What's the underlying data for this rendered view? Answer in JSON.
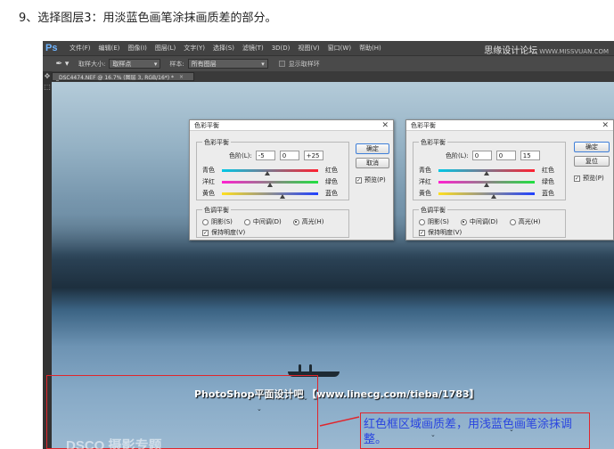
{
  "heading": "9、选择图层3：用淡蓝色画笔涂抹画质差的部分。",
  "app": {
    "logo": "Ps",
    "menu": [
      "文件(F)",
      "编辑(E)",
      "图像(I)",
      "图层(L)",
      "文字(Y)",
      "选择(S)",
      "滤镜(T)",
      "3D(D)",
      "视图(V)",
      "窗口(W)",
      "帮助(H)"
    ],
    "watermark": "思缘设计论坛",
    "watermark_url": "WWW.MISSVUAN.COM"
  },
  "options": {
    "preset_icon": "eyedropper-icon",
    "sample_size_label": "取样大小:",
    "sample_size_value": "取样点",
    "sample_label": "样本:",
    "sample_value": "所有图层",
    "show_ring_label": "显示取样环"
  },
  "document": {
    "tab_title": "_DSC4474.NEF @ 16.7% (图层 3, RGB/16*) *",
    "tab_close": "×"
  },
  "dialog_left": {
    "title": "色彩平衡",
    "color_balance_group": "色彩平衡",
    "levels_label": "色阶(L):",
    "levels": [
      "-5",
      "0",
      "+25"
    ],
    "sliders": [
      {
        "left": "青色",
        "right": "红色",
        "value": -5
      },
      {
        "left": "洋红",
        "right": "绿色",
        "value": 0
      },
      {
        "left": "黄色",
        "right": "蓝色",
        "value": 25
      }
    ],
    "tone_group": "色调平衡",
    "tones": [
      "阴影(S)",
      "中间调(D)",
      "高光(H)"
    ],
    "selected_tone": 2,
    "preserve_label": "保持明度(V)",
    "ok": "确定",
    "cancel": "取消",
    "preview": "预览(P)"
  },
  "dialog_right": {
    "title": "色彩平衡",
    "color_balance_group": "色彩平衡",
    "levels_label": "色阶(L):",
    "levels": [
      "0",
      "0",
      "15"
    ],
    "sliders": [
      {
        "left": "青色",
        "right": "红色",
        "value": 0
      },
      {
        "left": "洋红",
        "right": "绿色",
        "value": 0
      },
      {
        "left": "黄色",
        "right": "蓝色",
        "value": 15
      }
    ],
    "tone_group": "色调平衡",
    "tones": [
      "阴影(S)",
      "中间调(D)",
      "高光(H)"
    ],
    "selected_tone": 1,
    "preserve_label": "保持明度(V)",
    "ok": "确定",
    "cancel": "复位",
    "preview": "预览(P)"
  },
  "footer_watermark": "PhotoShop平面设计吧  【www.linecg.com/tieba/1783】",
  "annotation": "红色框区域画质差，用浅蓝色画笔涂抹调整。",
  "bottom_logo": "DSCO 摄影专题",
  "colors": {
    "red_box": "#e0262c",
    "annotation": "#2a45e0"
  }
}
